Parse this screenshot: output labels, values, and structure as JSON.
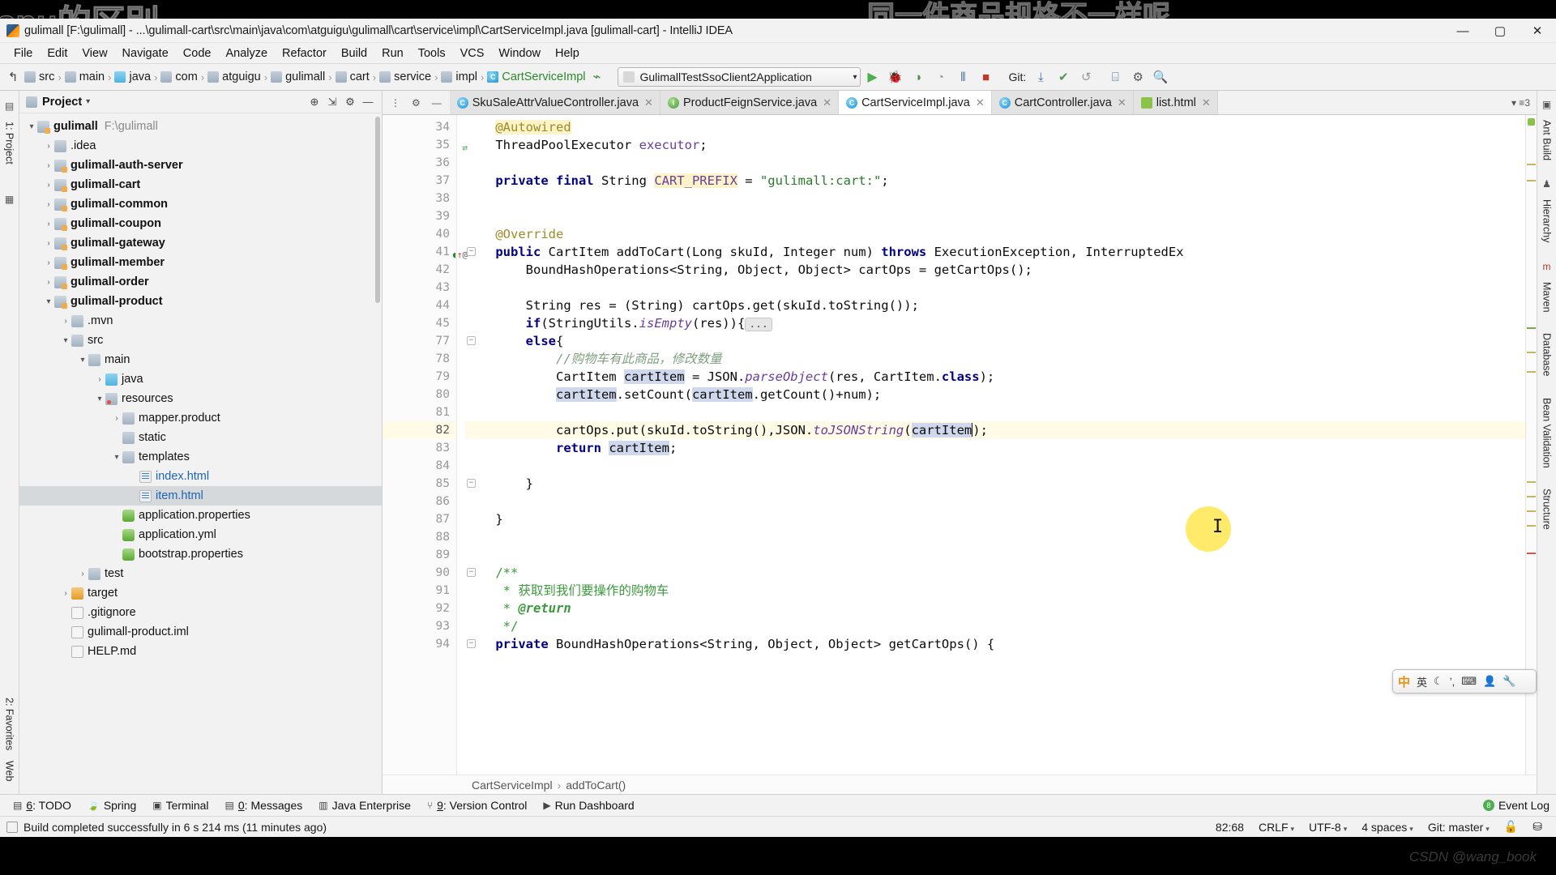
{
  "watermarks": {
    "left": "spu的区别",
    "top": "同一件商品规格不一样呢",
    "bottom": "CSDN @wang_book"
  },
  "titlebar": {
    "title": "gulimall [F:\\gulimall] - ...\\gulimall-cart\\src\\main\\java\\com\\atguigu\\gulimall\\cart\\service\\impl\\CartServiceImpl.java [gulimall-cart] - IntelliJ IDEA",
    "minimize": "—",
    "maximize": "▢",
    "close": "✕"
  },
  "menubar": {
    "items": [
      "File",
      "Edit",
      "View",
      "Navigate",
      "Code",
      "Analyze",
      "Refactor",
      "Build",
      "Run",
      "Tools",
      "VCS",
      "Window",
      "Help"
    ]
  },
  "navbar": {
    "crumbs": [
      {
        "label": "src",
        "icon": "folder-icon"
      },
      {
        "label": "main",
        "icon": "folder-icon"
      },
      {
        "label": "java",
        "icon": "folder-blue-icon"
      },
      {
        "label": "com",
        "icon": "folder-icon"
      },
      {
        "label": "atguigu",
        "icon": "folder-icon"
      },
      {
        "label": "gulimall",
        "icon": "folder-icon"
      },
      {
        "label": "cart",
        "icon": "folder-icon"
      },
      {
        "label": "service",
        "icon": "folder-icon"
      },
      {
        "label": "impl",
        "icon": "folder-icon"
      },
      {
        "label": "CartServiceImpl",
        "icon": "class-icon"
      }
    ],
    "run_config": "GulimallTestSsoClient2Application",
    "git_label": "Git:"
  },
  "project_panel": {
    "title": "Project",
    "tree": [
      {
        "depth": 0,
        "arrow": "▾",
        "icon": "module-icon",
        "label": "gulimall",
        "bold": true,
        "path": "F:\\gulimall"
      },
      {
        "depth": 1,
        "arrow": "›",
        "icon": "folder-icon",
        "label": ".idea"
      },
      {
        "depth": 1,
        "arrow": "›",
        "icon": "module-icon",
        "label": "gulimall-auth-server",
        "bold": true
      },
      {
        "depth": 1,
        "arrow": "›",
        "icon": "module-icon",
        "label": "gulimall-cart",
        "bold": true
      },
      {
        "depth": 1,
        "arrow": "›",
        "icon": "module-icon",
        "label": "gulimall-common",
        "bold": true
      },
      {
        "depth": 1,
        "arrow": "›",
        "icon": "module-icon",
        "label": "gulimall-coupon",
        "bold": true
      },
      {
        "depth": 1,
        "arrow": "›",
        "icon": "module-icon",
        "label": "gulimall-gateway",
        "bold": true
      },
      {
        "depth": 1,
        "arrow": "›",
        "icon": "module-icon",
        "label": "gulimall-member",
        "bold": true
      },
      {
        "depth": 1,
        "arrow": "›",
        "icon": "module-icon",
        "label": "gulimall-order",
        "bold": true
      },
      {
        "depth": 1,
        "arrow": "▾",
        "icon": "module-icon",
        "label": "gulimall-product",
        "bold": true
      },
      {
        "depth": 2,
        "arrow": "›",
        "icon": "folder-icon",
        "label": ".mvn"
      },
      {
        "depth": 2,
        "arrow": "▾",
        "icon": "folder-icon",
        "label": "src"
      },
      {
        "depth": 3,
        "arrow": "▾",
        "icon": "folder-icon",
        "label": "main"
      },
      {
        "depth": 4,
        "arrow": "›",
        "icon": "folder-blue-icon",
        "label": "java"
      },
      {
        "depth": 4,
        "arrow": "▾",
        "icon": "resources-icon",
        "label": "resources"
      },
      {
        "depth": 5,
        "arrow": "›",
        "icon": "folder-icon",
        "label": "mapper.product"
      },
      {
        "depth": 5,
        "arrow": "",
        "icon": "folder-icon",
        "label": "static"
      },
      {
        "depth": 5,
        "arrow": "▾",
        "icon": "folder-icon",
        "label": "templates"
      },
      {
        "depth": 6,
        "arrow": "",
        "icon": "html-icon",
        "label": "index.html",
        "blue": true
      },
      {
        "depth": 6,
        "arrow": "",
        "icon": "html-icon",
        "label": "item.html",
        "blue": true,
        "selected": true
      },
      {
        "depth": 5,
        "arrow": "",
        "icon": "properties-icon",
        "label": "application.properties"
      },
      {
        "depth": 5,
        "arrow": "",
        "icon": "properties-icon",
        "label": "application.yml"
      },
      {
        "depth": 5,
        "arrow": "",
        "icon": "properties-icon",
        "label": "bootstrap.properties"
      },
      {
        "depth": 3,
        "arrow": "›",
        "icon": "folder-icon",
        "label": "test"
      },
      {
        "depth": 2,
        "arrow": "›",
        "icon": "folder-orange-icon",
        "label": "target"
      },
      {
        "depth": 2,
        "arrow": "",
        "icon": "git-icon",
        "label": ".gitignore"
      },
      {
        "depth": 2,
        "arrow": "",
        "icon": "file-icon",
        "label": "gulimall-product.iml"
      },
      {
        "depth": 2,
        "arrow": "",
        "icon": "md-icon",
        "label": "HELP.md"
      }
    ]
  },
  "left_strip": {
    "top_tabs": [
      "1: Project"
    ],
    "bottom_tabs": [
      "2: Favorites",
      "Web"
    ]
  },
  "right_strip": {
    "tabs": [
      "Ant Build",
      "Maven",
      "Database",
      "Bean Validation"
    ],
    "extra": [
      "Hierarchy",
      "Structure"
    ]
  },
  "editor": {
    "tabs": [
      {
        "label": "SkuSaleAttrValueController.java",
        "icon": "class-icon",
        "active": false
      },
      {
        "label": "ProductFeignService.java",
        "icon": "interface-icon",
        "active": false
      },
      {
        "label": "CartServiceImpl.java",
        "icon": "class-icon",
        "active": true
      },
      {
        "label": "CartController.java",
        "icon": "class-icon",
        "active": false
      },
      {
        "label": "list.html",
        "icon": "html-icon",
        "active": false
      }
    ],
    "lines": [
      {
        "no": "34",
        "segs": [
          {
            "t": "    ",
            "c": ""
          },
          {
            "t": "@Autowired",
            "c": "anno-hl"
          }
        ]
      },
      {
        "no": "35",
        "segs": [
          {
            "t": "    ",
            "c": ""
          },
          {
            "t": "ThreadPoolExecutor ",
            "c": ""
          },
          {
            "t": "executor",
            "c": "fld"
          },
          {
            "t": ";",
            "c": ""
          }
        ],
        "mark": "green-arrow"
      },
      {
        "no": "36",
        "segs": []
      },
      {
        "no": "37",
        "segs": [
          {
            "t": "    ",
            "c": ""
          },
          {
            "t": "private final ",
            "c": "kw"
          },
          {
            "t": "String ",
            "c": ""
          },
          {
            "t": "CART_PREFIX",
            "c": "const"
          },
          {
            "t": " = ",
            "c": ""
          },
          {
            "t": "\"gulimall:cart:\"",
            "c": "str"
          },
          {
            "t": ";",
            "c": ""
          }
        ]
      },
      {
        "no": "38",
        "segs": []
      },
      {
        "no": "39",
        "segs": []
      },
      {
        "no": "40",
        "segs": [
          {
            "t": "    ",
            "c": ""
          },
          {
            "t": "@Override",
            "c": "anno"
          }
        ]
      },
      {
        "no": "41",
        "segs": [
          {
            "t": "    ",
            "c": ""
          },
          {
            "t": "public ",
            "c": "kw"
          },
          {
            "t": "CartItem addToCart(Long skuId, Integer num) ",
            "c": ""
          },
          {
            "t": "throws ",
            "c": "kw"
          },
          {
            "t": "ExecutionException, InterruptedEx",
            "c": ""
          }
        ],
        "mark": "override",
        "fold": "−"
      },
      {
        "no": "42",
        "segs": [
          {
            "t": "        BoundHashOperations<String, Object, Object> cartOps = getCartOps();",
            "c": ""
          }
        ]
      },
      {
        "no": "43",
        "segs": []
      },
      {
        "no": "44",
        "segs": [
          {
            "t": "        String res = (String) cartOps.get(skuId.toString());",
            "c": ""
          }
        ]
      },
      {
        "no": "45",
        "segs": [
          {
            "t": "        ",
            "c": ""
          },
          {
            "t": "if",
            "c": "kw"
          },
          {
            "t": "(StringUtils.",
            "c": ""
          },
          {
            "t": "isEmpty",
            "c": "stat"
          },
          {
            "t": "(res)){",
            "c": ""
          }
        ],
        "foldbox": "..."
      },
      {
        "no": "77",
        "segs": [
          {
            "t": "        ",
            "c": ""
          },
          {
            "t": "else",
            "c": "kw"
          },
          {
            "t": "{",
            "c": ""
          }
        ],
        "fold": "−"
      },
      {
        "no": "78",
        "segs": [
          {
            "t": "            ",
            "c": ""
          },
          {
            "t": "//购物车有此商品，修改数量",
            "c": "cmt"
          }
        ]
      },
      {
        "no": "79",
        "segs": [
          {
            "t": "            CartItem ",
            "c": ""
          },
          {
            "t": "cartItem",
            "c": "sel"
          },
          {
            "t": " = JSON.",
            "c": ""
          },
          {
            "t": "parseObject",
            "c": "stat"
          },
          {
            "t": "(res, CartItem.",
            "c": ""
          },
          {
            "t": "class",
            "c": "kw"
          },
          {
            "t": ");",
            "c": ""
          }
        ]
      },
      {
        "no": "80",
        "segs": [
          {
            "t": "            ",
            "c": ""
          },
          {
            "t": "cartItem",
            "c": "sel"
          },
          {
            "t": ".setCount(",
            "c": ""
          },
          {
            "t": "cartItem",
            "c": "sel"
          },
          {
            "t": ".getCount()+num);",
            "c": ""
          }
        ]
      },
      {
        "no": "81",
        "segs": []
      },
      {
        "no": "82",
        "segs": [
          {
            "t": "            cartOps.put(skuId.toString(),JSON.",
            "c": ""
          },
          {
            "t": "toJSONString",
            "c": "stat"
          },
          {
            "t": "(",
            "c": ""
          },
          {
            "t": "cartItem",
            "c": "sel"
          },
          {
            "t": ");",
            "c": ""
          }
        ],
        "current": true
      },
      {
        "no": "83",
        "segs": [
          {
            "t": "            ",
            "c": ""
          },
          {
            "t": "return ",
            "c": "kw"
          },
          {
            "t": "cartItem",
            "c": "sel"
          },
          {
            "t": ";",
            "c": ""
          }
        ]
      },
      {
        "no": "84",
        "segs": []
      },
      {
        "no": "85",
        "segs": [
          {
            "t": "        }",
            "c": ""
          }
        ],
        "fold": "−"
      },
      {
        "no": "86",
        "segs": []
      },
      {
        "no": "87",
        "segs": [
          {
            "t": "    }",
            "c": ""
          }
        ]
      },
      {
        "no": "88",
        "segs": []
      },
      {
        "no": "89",
        "segs": []
      },
      {
        "no": "90",
        "segs": [
          {
            "t": "    ",
            "c": ""
          },
          {
            "t": "/**",
            "c": "doc"
          }
        ],
        "fold": "−"
      },
      {
        "no": "91",
        "segs": [
          {
            "t": "     ",
            "c": ""
          },
          {
            "t": "* 获取到我们要操作的购物车",
            "c": "doc"
          }
        ]
      },
      {
        "no": "92",
        "segs": [
          {
            "t": "     ",
            "c": ""
          },
          {
            "t": "* ",
            "c": "doc"
          },
          {
            "t": "@return",
            "c": "doctag"
          }
        ]
      },
      {
        "no": "93",
        "segs": [
          {
            "t": "     ",
            "c": ""
          },
          {
            "t": "*/",
            "c": "doc"
          }
        ]
      },
      {
        "no": "94",
        "segs": [
          {
            "t": "    ",
            "c": ""
          },
          {
            "t": "private ",
            "c": "kw"
          },
          {
            "t": "BoundHashOperations<String, Object, Object> getCartOps() {",
            "c": ""
          }
        ],
        "fold": "−"
      }
    ],
    "breadcrumb": [
      "CartServiceImpl",
      "addToCart()"
    ]
  },
  "bottom_tools": [
    {
      "num": "6",
      "label": "TODO",
      "icon": "list-icon"
    },
    {
      "num": "",
      "label": "Spring",
      "icon": "leaf-icon"
    },
    {
      "num": "",
      "label": "Terminal",
      "icon": "terminal-icon"
    },
    {
      "num": "0",
      "label": "Messages",
      "icon": "messages-icon"
    },
    {
      "num": "",
      "label": "Java Enterprise",
      "icon": "java-icon"
    },
    {
      "num": "9",
      "label": "Version Control",
      "icon": "vcs-icon"
    },
    {
      "num": "",
      "label": "Run Dashboard",
      "icon": "run-icon"
    }
  ],
  "event_log": {
    "label": "Event Log",
    "badge": "8"
  },
  "statusbar": {
    "message": "Build completed successfully in 6 s 214 ms (11 minutes ago)",
    "caret": "82:68",
    "line_sep": "CRLF",
    "encoding": "UTF-8",
    "indent": "4 spaces",
    "branch": "Git: master"
  },
  "ime": {
    "logo": "中",
    "mode": "英",
    "items": [
      "☾",
      "ʼ,",
      "⌨",
      "👤",
      "🔧"
    ]
  }
}
